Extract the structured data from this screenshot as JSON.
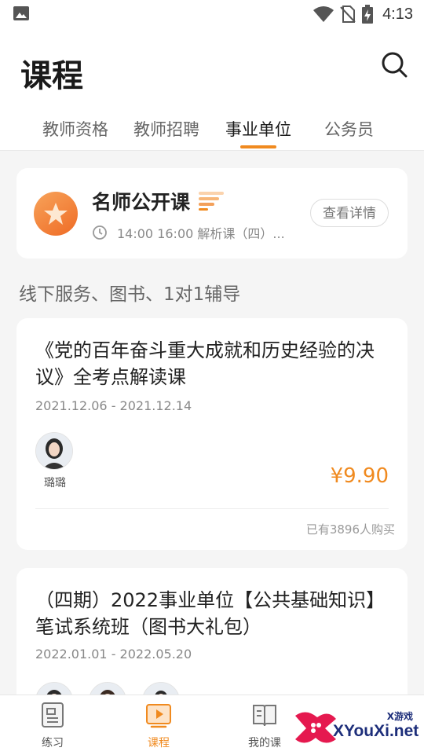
{
  "status_bar": {
    "time": "4:13"
  },
  "header": {
    "title": "课程"
  },
  "tabs": [
    {
      "label": "教师资格",
      "active": false
    },
    {
      "label": "教师招聘",
      "active": false
    },
    {
      "label": "事业单位",
      "active": true
    },
    {
      "label": "公务员",
      "active": false
    }
  ],
  "featured": {
    "title": "名师公开课",
    "schedule": "14:00 16:00 解析课（四）...",
    "detail_button": "查看详情"
  },
  "section_title": "线下服务、图书、1对1辅导",
  "courses": [
    {
      "title": "《党的百年奋斗重大成就和历史经验的决议》全考点解读课",
      "date": "2021.12.06 - 2021.12.14",
      "teachers": [
        {
          "name": "璐璐"
        }
      ],
      "price": "¥9.90",
      "buyers": "已有3896人购买"
    },
    {
      "title": "（四期）2022事业单位【公共基础知识】笔试系统班（图书大礼包）",
      "date": "2022.01.01 - 2022.05.20"
    }
  ],
  "bottom_nav": [
    {
      "label": "练习",
      "active": false
    },
    {
      "label": "课程",
      "active": true
    },
    {
      "label": "我的课",
      "active": false
    }
  ],
  "watermark": {
    "text": "XYouXi.net",
    "small": "X游戏"
  },
  "colors": {
    "accent": "#f08a1f",
    "background": "#f5f5f5"
  }
}
